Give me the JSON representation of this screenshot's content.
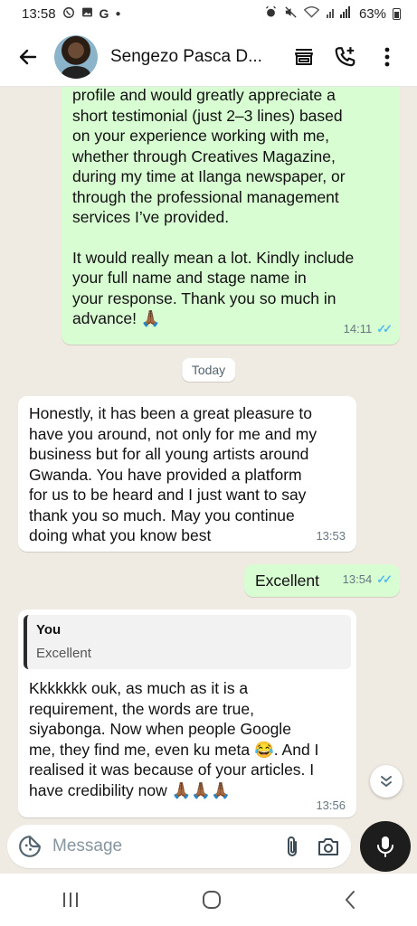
{
  "status_bar": {
    "time": "13:58",
    "notif_icons": [
      "whatsapp-icon",
      "gallery-icon",
      "google-icon",
      "dot-icon"
    ],
    "battery": "63%"
  },
  "header": {
    "contact_name": "Sengezo Pasca D...",
    "icons": [
      "back-arrow-icon",
      "store-icon",
      "add-call-icon",
      "more-vert-icon"
    ]
  },
  "messages": {
    "msg1": {
      "lines": [
        "profile and would greatly appreciate a",
        "short testimonial (just 2–3 lines) based",
        "on your experience working with me,",
        "whether through Creatives Magazine,",
        "during my time at Ilanga newspaper, or",
        "through the professional management",
        "services I’ve provided.",
        "",
        "It would really mean a lot. Kindly include",
        "your full name and stage name in",
        "your response. Thank you so much in",
        "advance! 🙏🏾"
      ],
      "time": "14:11"
    },
    "date_chip": "Today",
    "msg2": {
      "lines": [
        "Honestly, it has been a great pleasure to",
        "have you around, not only for me and my",
        "business but for all young artists around",
        "Gwanda. You have provided a platform",
        "for us to be heard and I just want to say",
        "thank you so much. May you continue",
        "doing what you know best"
      ],
      "time": "13:53"
    },
    "msg3": {
      "text": "Excellent",
      "time": "13:54"
    },
    "msg4": {
      "quote_author": "You",
      "quote_text": "Excellent",
      "lines": [
        "Kkkkkkk ouk, as much as it is a",
        "requirement, the words are true,",
        "siyabonga. Now when people Google",
        "me, they find me, even ku meta 😂. And I",
        "realised it was because of your articles. I",
        "have credibility now 🙏🏾🙏🏾🙏🏾"
      ],
      "time": "13:56"
    }
  },
  "composer": {
    "placeholder": "Message"
  },
  "colors": {
    "outgoing": "#d9fdd3",
    "incoming": "#ffffff",
    "read_ticks": "#53bdeb",
    "background": "#efeae2"
  }
}
